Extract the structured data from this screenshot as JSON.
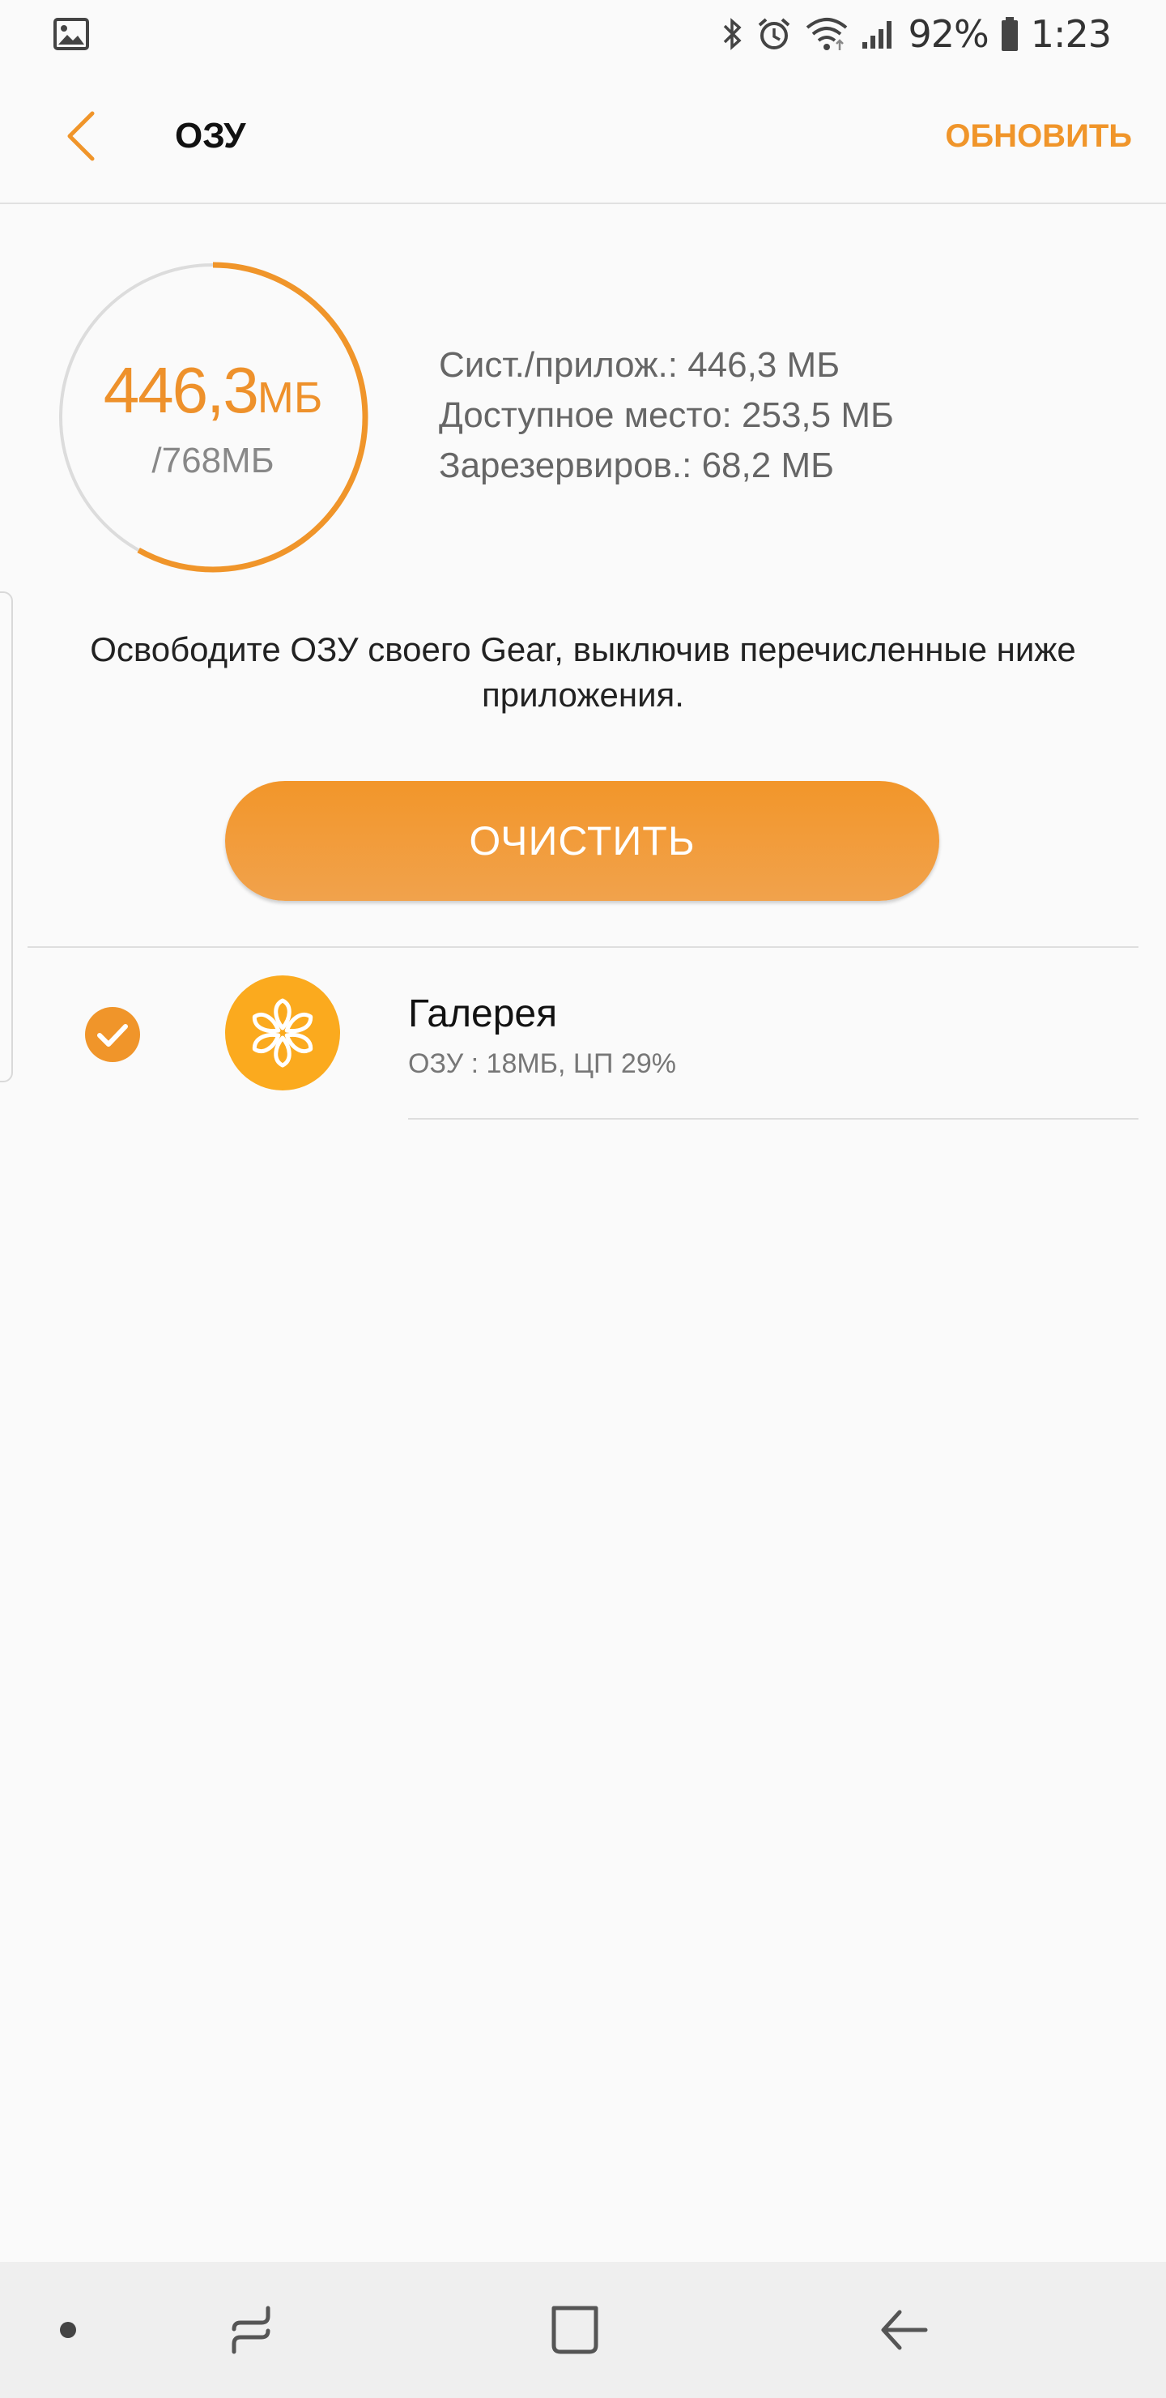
{
  "status_bar": {
    "battery": "92%",
    "time": "1:23"
  },
  "header": {
    "title": "ОЗУ",
    "refresh_label": "ОБНОВИТЬ"
  },
  "memory": {
    "used_value": "446,3",
    "used_unit": "МБ",
    "total": "/768МБ",
    "used_fraction": 0.581,
    "stats": [
      "Сист./прилож.: 446,3 МБ",
      "Доступное место: 253,5 МБ",
      "Зарезервиров.: 68,2 МБ"
    ]
  },
  "description": "Освободите ОЗУ своего Gear, выключив перечисленные ниже приложения.",
  "clean_button_label": "ОЧИСТИТЬ",
  "apps": [
    {
      "name": "Галерея",
      "info": "ОЗУ : 18МБ, ЦП 29%",
      "checked": true
    }
  ],
  "colors": {
    "accent": "#f0952a",
    "ring_track": "#dcdcdc",
    "gallery_icon": "#fbaa1e"
  },
  "icons": {
    "status_left": "gallery-notification-icon",
    "status": [
      "bluetooth-icon",
      "alarm-icon",
      "wifi-icon",
      "signal-icon",
      "battery-icon"
    ],
    "nav": [
      "nav-dot-icon",
      "recent-apps-icon",
      "home-icon",
      "back-icon"
    ]
  }
}
